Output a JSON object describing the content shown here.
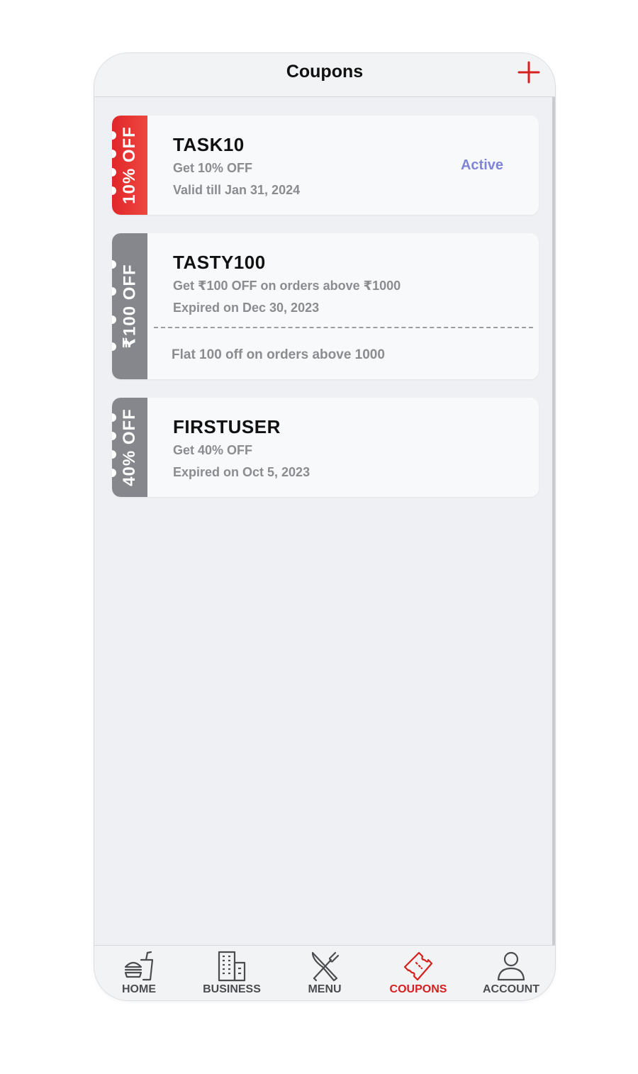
{
  "header": {
    "title": "Coupons",
    "add_icon": "plus-icon"
  },
  "coupons": [
    {
      "stub_label": "10% OFF",
      "stub_color": "#e32b2c",
      "code": "TASK10",
      "description": "Get 10% OFF",
      "validity": "Valid till Jan 31, 2024",
      "status": "Active",
      "note": ""
    },
    {
      "stub_label": "₹100 OFF",
      "stub_color": "#85878c",
      "code": "TASTY100",
      "description": "Get ₹100 OFF on orders above ₹1000",
      "validity": "Expired on Dec 30, 2023",
      "status": "",
      "note": "Flat 100 off on orders above 1000"
    },
    {
      "stub_label": "40% OFF",
      "stub_color": "#85878c",
      "code": "FIRSTUSER",
      "description": "Get 40% OFF",
      "validity": "Expired on Oct 5, 2023",
      "status": "",
      "note": ""
    }
  ],
  "nav": {
    "items": [
      {
        "label": "HOME",
        "icon": "burger-drink-icon"
      },
      {
        "label": "BUSINESS",
        "icon": "building-icon"
      },
      {
        "label": "MENU",
        "icon": "fork-knife-icon"
      },
      {
        "label": "COUPONS",
        "icon": "ticket-icon"
      },
      {
        "label": "ACCOUNT",
        "icon": "user-icon"
      }
    ],
    "active": "COUPONS",
    "active_color": "#d61f1f",
    "inactive_color": "#4a4c50"
  }
}
